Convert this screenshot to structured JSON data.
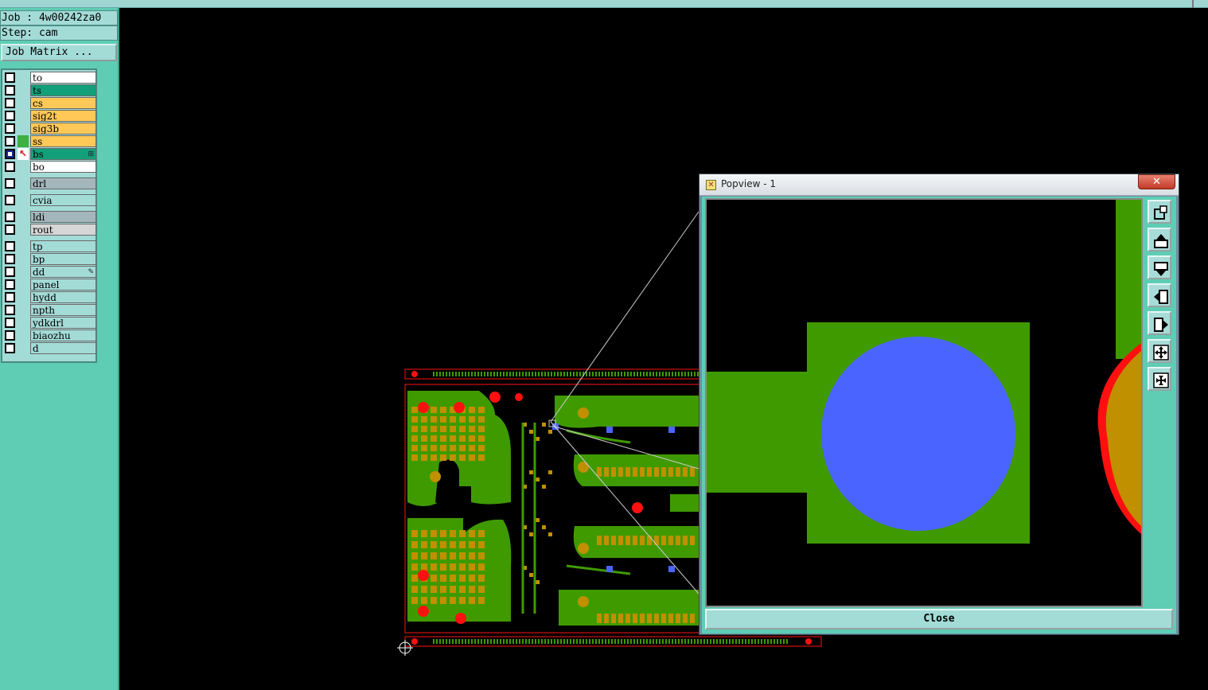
{
  "header": {
    "job_label": "Job : 4w00242za0",
    "step_label": "Step: cam",
    "job_matrix_button": "Job Matrix ..."
  },
  "layers": [
    {
      "name": "to",
      "color": "#ffffff",
      "mark": "",
      "tag": ""
    },
    {
      "name": "ts",
      "color": "#12a07a",
      "mark": "",
      "tag": ""
    },
    {
      "name": "cs",
      "color": "#ffc857",
      "mark": "",
      "tag": ""
    },
    {
      "name": "sig2t",
      "color": "#ffc857",
      "mark": "",
      "tag": ""
    },
    {
      "name": "sig3b",
      "color": "#ffc857",
      "mark": "",
      "tag": ""
    },
    {
      "name": "ss",
      "color": "#ffc857",
      "mark": "green",
      "tag": ""
    },
    {
      "name": "bs",
      "color": "#12a07a",
      "mark": "arrow",
      "tag": "⊞",
      "selected": true
    },
    {
      "name": "bo",
      "color": "#ffffff",
      "mark": "",
      "tag": ""
    },
    {
      "name": "drl",
      "color": "#a3b6bc",
      "mark": "",
      "tag": ""
    },
    {
      "name": "cvia",
      "color": "#a3dbd7",
      "mark": "",
      "tag": ""
    },
    {
      "name": "ldi",
      "color": "#a3b6bc",
      "mark": "",
      "tag": ""
    },
    {
      "name": "rout",
      "color": "#d6d6d6",
      "mark": "",
      "tag": ""
    },
    {
      "name": "tp",
      "color": "#a3dbd7",
      "mark": "",
      "tag": ""
    },
    {
      "name": "bp",
      "color": "#a3dbd7",
      "mark": "",
      "tag": ""
    },
    {
      "name": "dd",
      "color": "#a3dbd7",
      "mark": "",
      "tag": "✎"
    },
    {
      "name": "panel",
      "color": "#a3dbd7",
      "mark": "",
      "tag": ""
    },
    {
      "name": "hydd",
      "color": "#a3dbd7",
      "mark": "",
      "tag": ""
    },
    {
      "name": "npth",
      "color": "#a3dbd7",
      "mark": "",
      "tag": ""
    },
    {
      "name": "ydkdrl",
      "color": "#a3dbd7",
      "mark": "",
      "tag": ""
    },
    {
      "name": "biaozhu",
      "color": "#a3dbd7",
      "mark": "",
      "tag": ""
    },
    {
      "name": "d",
      "color": "#a3dbd7",
      "mark": "",
      "tag": ""
    }
  ],
  "popview": {
    "title": "Popview - 1",
    "close_x": "✕",
    "close_label": "Close",
    "tools": [
      "zoom-window-icon",
      "pan-up-icon",
      "pan-down-icon",
      "pan-left-icon",
      "pan-right-icon",
      "zoom-in-icon",
      "zoom-out-icon"
    ]
  },
  "colors": {
    "copper_green": "#3f9a00",
    "copper_gold": "#c09000",
    "pad_blue": "#4a64ff",
    "drill_red": "#ff1010",
    "panel_teal": "#5ecdb4"
  }
}
